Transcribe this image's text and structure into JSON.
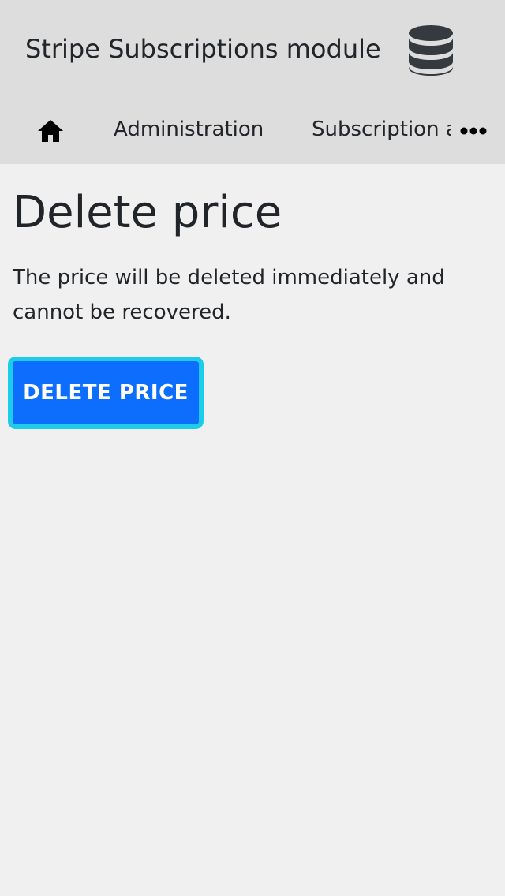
{
  "header": {
    "app_title": "Stripe Subscriptions module",
    "icon": "database-icon"
  },
  "nav": {
    "home_icon": "home-icon",
    "items": [
      {
        "label": "Administration"
      },
      {
        "label": "Subscription a"
      }
    ],
    "more_icon": "more-horizontal-icon"
  },
  "main": {
    "title": "Delete price",
    "description": "The price will be deleted immediately and cannot be recovered.",
    "delete_button_label": "DELETE PRICE"
  },
  "colors": {
    "header_bg": "#dddddd",
    "page_bg": "#f0f0f0",
    "primary": "#0d6efd",
    "focus_ring": "#1ccce8"
  }
}
